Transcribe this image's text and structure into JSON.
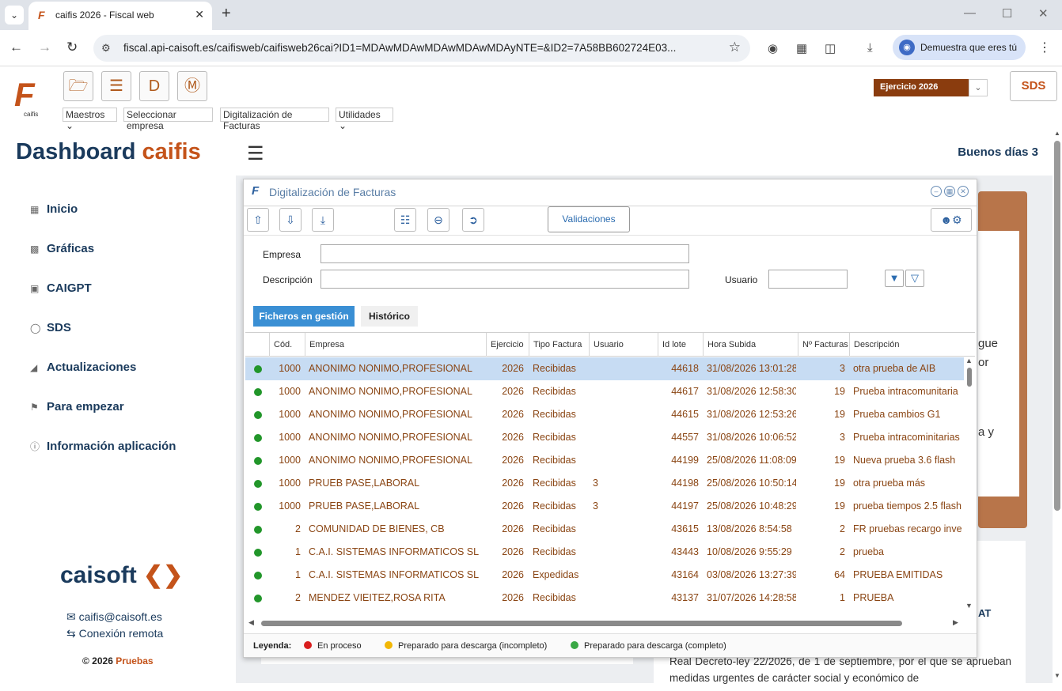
{
  "browser": {
    "tab_title": "caifis 2026 - Fiscal web",
    "url": "fiscal.api-caisoft.es/caifisweb/caifisweb26cai?ID1=MDAwMDAwMDAwMDAwMDAyNTE=&ID2=7A58BB602724E03...",
    "profile_label": "Demuestra que eres tú"
  },
  "app": {
    "logo_text": "caifis",
    "menu": [
      "Maestros",
      "Seleccionar empresa",
      "Digitalización de Facturas",
      "Utilidades"
    ],
    "ejercicio": "Ejercicio 2026",
    "sds_label": "SDS",
    "dashboard_title_a": "Dashboard",
    "dashboard_title_b": "caifis",
    "greeting": "Buenos días 3"
  },
  "sidebar": {
    "items": [
      "Inicio",
      "Gráficas",
      "CAIGPT",
      "SDS",
      "Actualizaciones",
      "Para empezar",
      "Información aplicación"
    ],
    "brand": "caisoft",
    "email": "caifis@caisoft.es",
    "remote": "Conexión remota",
    "copyright_a": "© 2026",
    "copyright_b": "Pruebas"
  },
  "background": {
    "snippet_1": "gue",
    "snippet_2": "or",
    "snippet_3": "a y",
    "news_heading": "AT",
    "news_text": "Real Decreto-ley 22/2026, de 1 de septiembre, por el que se aprueban medidas urgentes de carácter social y económico de"
  },
  "modal": {
    "title": "Digitalización de Facturas",
    "validaciones": "Validaciones",
    "empresa_label": "Empresa",
    "descripcion_label": "Descripción",
    "usuario_label": "Usuario",
    "tab_active": "Ficheros en gestión",
    "tab_inactive": "Histórico",
    "columns": [
      "Cód.",
      "Empresa",
      "Ejercicio",
      "Tipo Factura",
      "Usuario",
      "Id lote",
      "Hora Subida",
      "Nº Facturas",
      "Descripción"
    ],
    "rows": [
      {
        "cod": "1000",
        "empresa": "ANONIMO NONIMO,PROFESIONAL",
        "ejercicio": "2026",
        "tipo": "Recibidas",
        "usuario": "",
        "lote": "44618",
        "hora": "31/08/2026 13:01:28",
        "nfact": "3",
        "desc": "otra prueba de AIB"
      },
      {
        "cod": "1000",
        "empresa": "ANONIMO NONIMO,PROFESIONAL",
        "ejercicio": "2026",
        "tipo": "Recibidas",
        "usuario": "",
        "lote": "44617",
        "hora": "31/08/2026 12:58:30",
        "nfact": "19",
        "desc": "Prueba intracomunitaria"
      },
      {
        "cod": "1000",
        "empresa": "ANONIMO NONIMO,PROFESIONAL",
        "ejercicio": "2026",
        "tipo": "Recibidas",
        "usuario": "",
        "lote": "44615",
        "hora": "31/08/2026 12:53:26",
        "nfact": "19",
        "desc": "Prueba cambios G1"
      },
      {
        "cod": "1000",
        "empresa": "ANONIMO NONIMO,PROFESIONAL",
        "ejercicio": "2026",
        "tipo": "Recibidas",
        "usuario": "",
        "lote": "44557",
        "hora": "31/08/2026 10:06:52",
        "nfact": "3",
        "desc": "Prueba intracominitarias"
      },
      {
        "cod": "1000",
        "empresa": "ANONIMO NONIMO,PROFESIONAL",
        "ejercicio": "2026",
        "tipo": "Recibidas",
        "usuario": "",
        "lote": "44199",
        "hora": "25/08/2026 11:08:09",
        "nfact": "19",
        "desc": "Nueva prueba 3.6 flash"
      },
      {
        "cod": "1000",
        "empresa": "PRUEB PASE,LABORAL",
        "ejercicio": "2026",
        "tipo": "Recibidas",
        "usuario": "3",
        "lote": "44198",
        "hora": "25/08/2026 10:50:14",
        "nfact": "19",
        "desc": "otra prueba más"
      },
      {
        "cod": "1000",
        "empresa": "PRUEB PASE,LABORAL",
        "ejercicio": "2026",
        "tipo": "Recibidas",
        "usuario": "3",
        "lote": "44197",
        "hora": "25/08/2026 10:48:29",
        "nfact": "19",
        "desc": "prueba tiempos 2.5 flash"
      },
      {
        "cod": "2",
        "empresa": "COMUNIDAD DE BIENES, CB",
        "ejercicio": "2026",
        "tipo": "Recibidas",
        "usuario": "",
        "lote": "43615",
        "hora": "13/08/2026 8:54:58",
        "nfact": "2",
        "desc": "FR pruebas recargo inve"
      },
      {
        "cod": "1",
        "empresa": "C.A.I. SISTEMAS INFORMATICOS SL",
        "ejercicio": "2026",
        "tipo": "Recibidas",
        "usuario": "",
        "lote": "43443",
        "hora": "10/08/2026 9:55:29",
        "nfact": "2",
        "desc": "prueba"
      },
      {
        "cod": "1",
        "empresa": "C.A.I. SISTEMAS INFORMATICOS SL",
        "ejercicio": "2026",
        "tipo": "Expedidas",
        "usuario": "",
        "lote": "43164",
        "hora": "03/08/2026 13:27:39",
        "nfact": "64",
        "desc": "PRUEBA EMITIDAS"
      },
      {
        "cod": "2",
        "empresa": "MENDEZ VIEITEZ,ROSA RITA",
        "ejercicio": "2026",
        "tipo": "Recibidas",
        "usuario": "",
        "lote": "43137",
        "hora": "31/07/2026 14:28:58",
        "nfact": "1",
        "desc": "PRUEBA"
      }
    ],
    "legend_label": "Leyenda:",
    "legend": [
      {
        "label": "En proceso",
        "color": "#d91e1e"
      },
      {
        "label": "Preparado para descarga (incompleto)",
        "color": "#f2b705"
      },
      {
        "label": "Preparado para descarga (completo)",
        "color": "#3aa845"
      }
    ]
  }
}
